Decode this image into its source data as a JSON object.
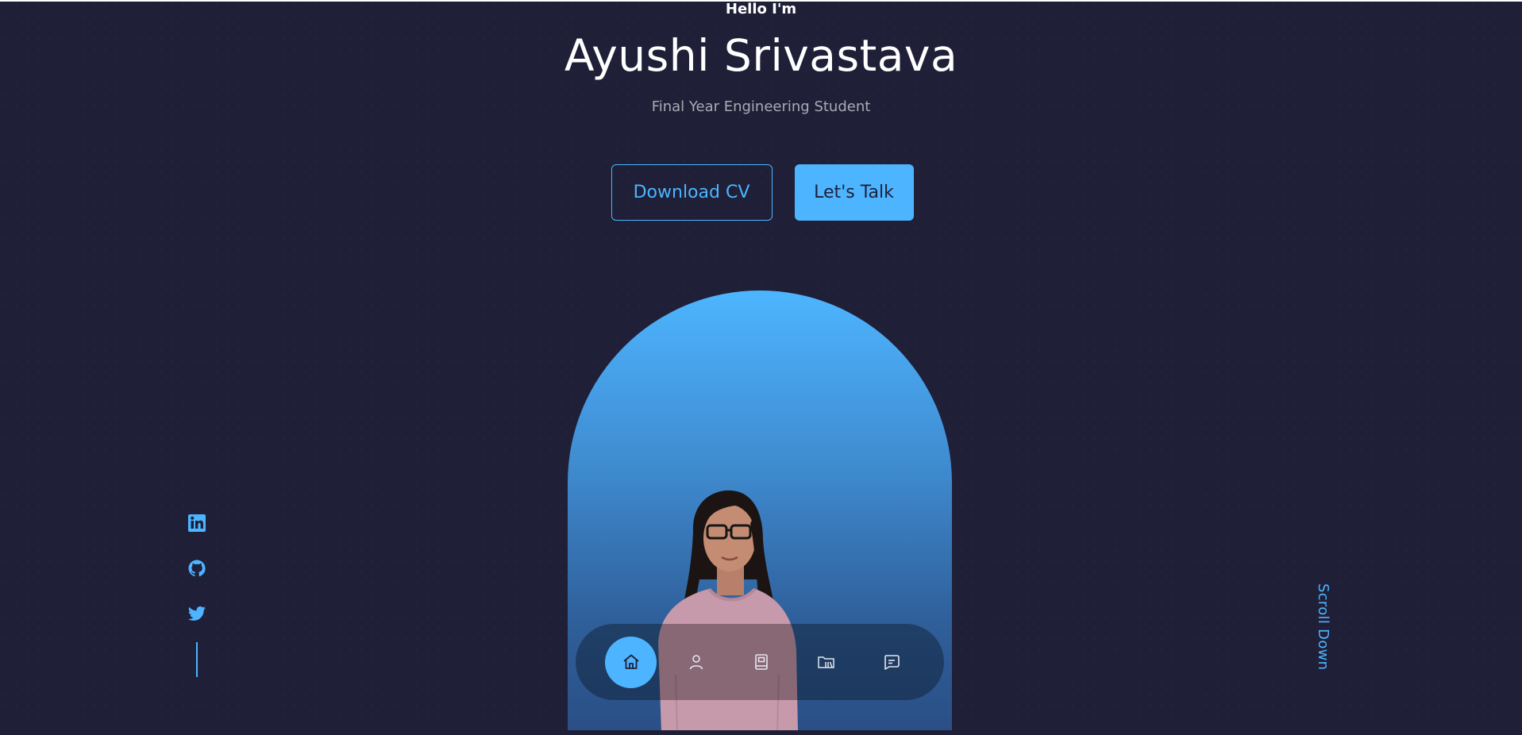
{
  "header": {
    "greeting": "Hello I'm",
    "name": "Ayushi Srivastava",
    "subtitle": "Final Year Engineering Student"
  },
  "cta": {
    "download_label": "Download CV",
    "talk_label": "Let's Talk"
  },
  "socials": [
    {
      "icon": "linkedin-icon"
    },
    {
      "icon": "github-icon"
    },
    {
      "icon": "twitter-icon"
    }
  ],
  "scroll": {
    "label": "Scroll Down"
  },
  "nav": {
    "items": [
      {
        "icon": "home-icon",
        "active": true
      },
      {
        "icon": "user-icon",
        "active": false
      },
      {
        "icon": "book-icon",
        "active": false
      },
      {
        "icon": "folder-library-icon",
        "active": false
      },
      {
        "icon": "message-icon",
        "active": false
      }
    ]
  },
  "colors": {
    "background": "#1f1f38",
    "accent": "#4db5ff",
    "text": "#ffffff"
  }
}
